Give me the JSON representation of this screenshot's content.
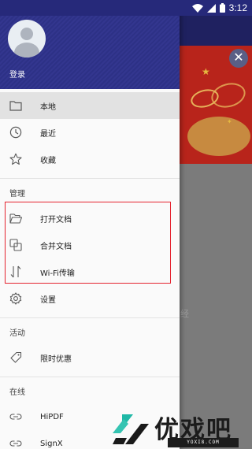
{
  "status_bar": {
    "time": "3:12",
    "icons": [
      "wifi-icon",
      "signal-icon",
      "battery-icon"
    ]
  },
  "colors": {
    "header": "#2f3388",
    "accent_red": "#e5232f",
    "active_bg": "#e2e2e2"
  },
  "drawer": {
    "login_label": "登录",
    "top_items": [
      {
        "label": "本地",
        "icon": "folder-icon",
        "active": true
      },
      {
        "label": "最近",
        "icon": "clock-icon"
      },
      {
        "label": "收藏",
        "icon": "star-icon"
      }
    ],
    "manage_section": {
      "title": "管理",
      "items": [
        {
          "label": "打开文档",
          "icon": "open-folder-icon"
        },
        {
          "label": "合并文档",
          "icon": "merge-icon"
        },
        {
          "label": "Wi-Fi传输",
          "icon": "transfer-icon"
        },
        {
          "label": "设置",
          "icon": "gear-icon"
        }
      ]
    },
    "activity_section": {
      "title": "活动",
      "items": [
        {
          "label": "限时优惠",
          "icon": "tag-icon"
        }
      ]
    },
    "online_section": {
      "title": "在线",
      "items": [
        {
          "label": "HiPDF",
          "icon": "link-icon"
        },
        {
          "label": "SignX",
          "icon": "link-icon"
        }
      ]
    }
  },
  "background": {
    "close_glyph": "✕",
    "partial_text": "经"
  },
  "watermark": {
    "text": "优戏吧",
    "url": "YOXI8.COM"
  }
}
